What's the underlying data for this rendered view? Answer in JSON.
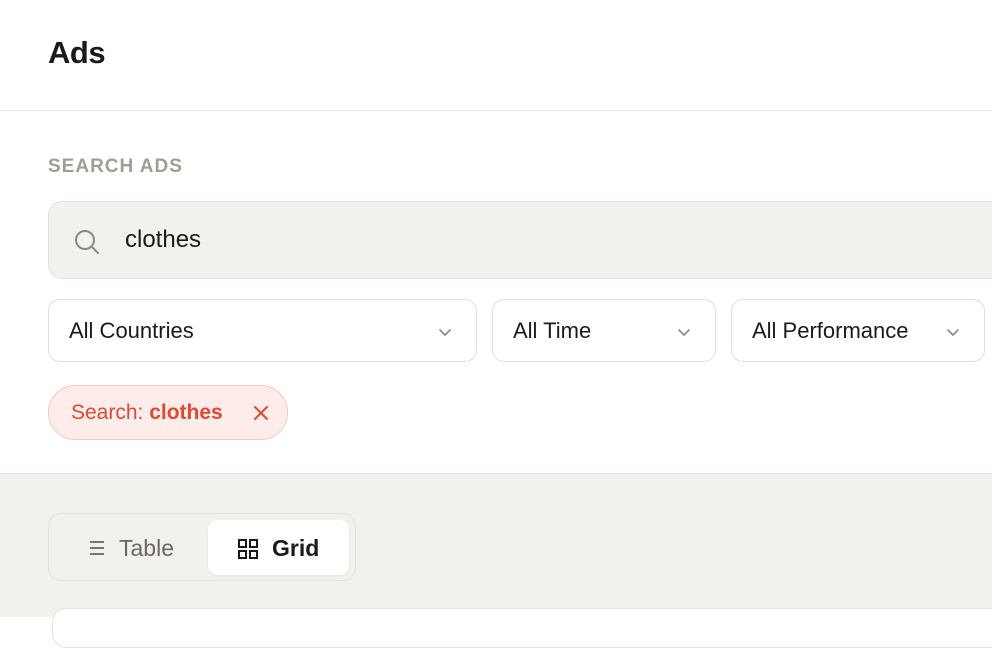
{
  "header": {
    "title": "Ads"
  },
  "search": {
    "heading": "SEARCH ADS",
    "query": "clothes",
    "icon": "search-icon"
  },
  "filters": {
    "countries": {
      "selected": "All Countries"
    },
    "time": {
      "selected": "All Time"
    },
    "performance": {
      "selected": "All Performance"
    }
  },
  "active_filters": [
    {
      "prefix": "Search:",
      "value": "clothes",
      "icon": "close-icon"
    }
  ],
  "view_toggle": {
    "options": [
      {
        "label": "Table",
        "icon": "list-icon",
        "active": false
      },
      {
        "label": "Grid",
        "icon": "grid-icon",
        "active": true
      }
    ]
  },
  "colors": {
    "accent_chip_text": "#dc4a30",
    "accent_chip_bg": "#fdecea",
    "surface_muted": "#f3f1ec",
    "text_primary": "#1c1917",
    "text_muted": "#a19d95"
  }
}
